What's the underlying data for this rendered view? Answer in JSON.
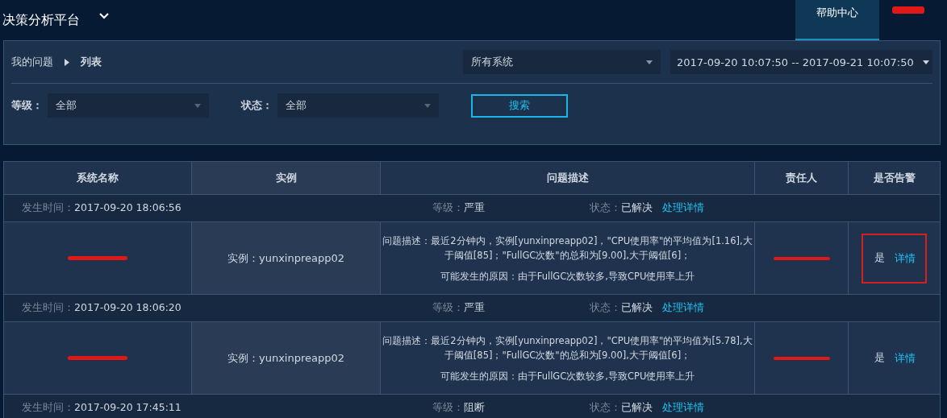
{
  "app": {
    "title": "决策分析平台",
    "help_tab": {
      "label": "帮助中心",
      "selected": true
    }
  },
  "filters": {
    "breadcrumb": [
      "我的问题",
      "列表"
    ],
    "system": "所有系统",
    "date_range": "2017-09-20 10:07:50 -- 2017-09-21 10:07:50",
    "level_label": "等级：",
    "level": "全部",
    "status_label": "状态：",
    "status": "全部",
    "search_button": "搜索"
  },
  "table": {
    "columns": [
      "系统名称",
      "实例",
      "问题描述",
      "责任人",
      "是否告警"
    ],
    "groups": [
      {
        "time_label": "发生时间：",
        "time": "2017-09-20 18:06:56",
        "level_label": "等级：",
        "level": "严重",
        "status_label": "状态：",
        "status": "已解决",
        "link": "处理详情",
        "row": {
          "instance": "实例：yunxinpreapp02",
          "description": "问题描述：最近2分钟内，实例[yunxinpreapp02]，\"CPU使用率\"的平均值为[1.16],大于阈值[85]；\"FullGC次数\"的总和为[9.00],大于阈值[6]；",
          "cause": "可能发生的原因：由于FullGC次数较多,导致CPU使用率上升",
          "alarm": "是",
          "detail": "详情",
          "highlighted": true
        }
      },
      {
        "time_label": "发生时间：",
        "time": "2017-09-20 18:06:20",
        "level_label": "等级：",
        "level": "严重",
        "status_label": "状态：",
        "status": "已解决",
        "link": "处理详情",
        "row": {
          "instance": "实例：yunxinpreapp02",
          "description": "问题描述：最近2分钟内，实例[yunxinpreapp02]，\"CPU使用率\"的平均值为[5.78],大于阈值[85]；\"FullGC次数\"的总和为[9.00],大于阈值[6]；",
          "cause": "可能发生的原因：由于FullGC次数较多,导致CPU使用率上升",
          "alarm": "是",
          "detail": "详情",
          "highlighted": false
        }
      },
      {
        "time_label": "发生时间：",
        "time": "2017-09-20 17:45:11",
        "level_label": "等级：",
        "level": "阻断",
        "status_label": "状态：",
        "status": "已解决",
        "link": "处理详情"
      }
    ]
  }
}
